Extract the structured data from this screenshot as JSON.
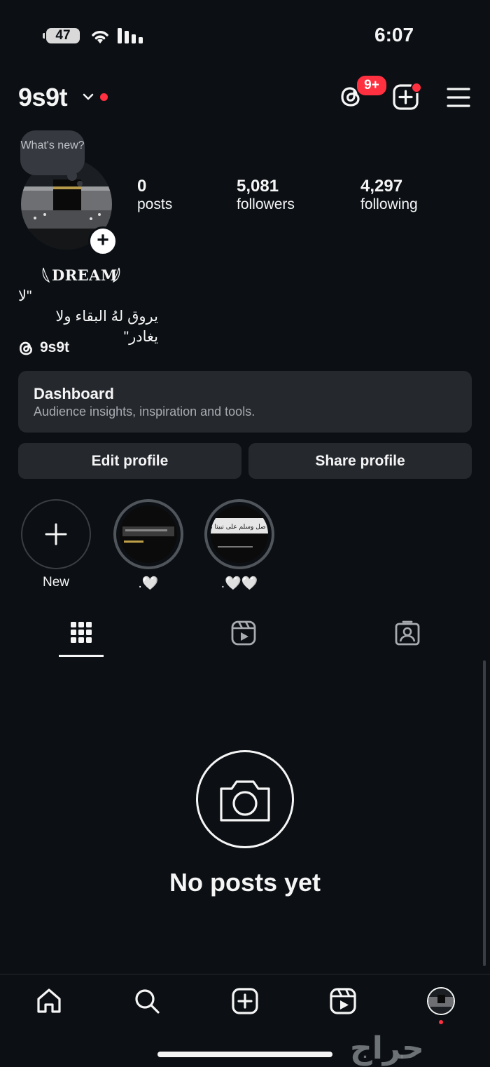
{
  "status_bar": {
    "battery": "47",
    "time": "6:07"
  },
  "header": {
    "username": "9s9t",
    "threads_badge": "9+",
    "icons": [
      "chevron-down-icon",
      "threads-icon",
      "create-icon",
      "menu-icon"
    ]
  },
  "profile": {
    "note_bubble": "What's new?",
    "stats": [
      {
        "value": "0",
        "label": "posts"
      },
      {
        "value": "5,081",
        "label": "followers"
      },
      {
        "value": "4,297",
        "label": "following"
      }
    ],
    "display_name": "DREAM",
    "bio_line1": "\"لا",
    "bio_line2": "يروق لهُ البقاء ولا يغادر\"",
    "threads_handle": "9s9t"
  },
  "dashboard": {
    "title": "Dashboard",
    "subtitle": "Audience insights, inspiration and tools."
  },
  "buttons": {
    "edit_profile": "Edit profile",
    "share_profile": "Share profile"
  },
  "highlights": [
    {
      "label": "New"
    },
    {
      "label": ".🤍"
    },
    {
      "label": ".🤍🤍"
    }
  ],
  "highlight_text": "اللهم صل وسلم على نبينا محمد",
  "tabs": [
    "grid-icon",
    "reels-icon",
    "tagged-icon"
  ],
  "empty_state": {
    "text": "No posts yet"
  },
  "bottom_nav": [
    "home-icon",
    "search-icon",
    "create-icon",
    "reels-icon",
    "profile-avatar"
  ],
  "watermark": "حراج",
  "colors": {
    "background": "#0c1014",
    "card": "#25292e",
    "accent_red": "#ff3040",
    "text": "#f5f5f5"
  }
}
